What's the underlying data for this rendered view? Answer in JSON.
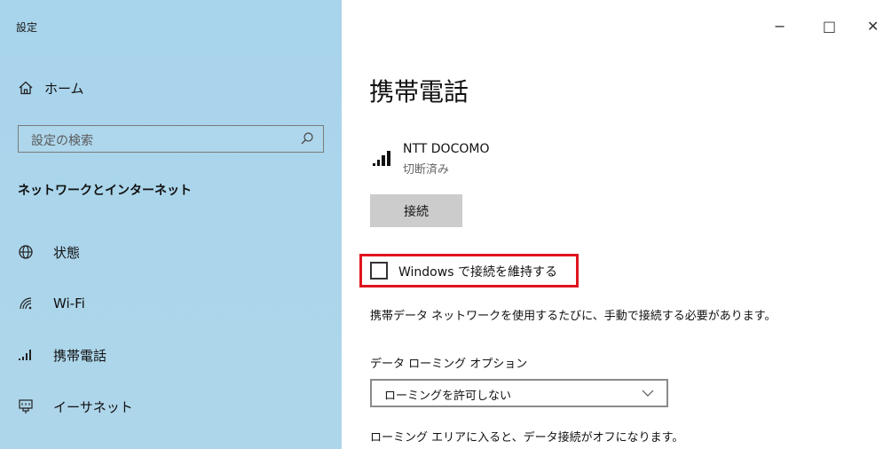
{
  "window": {
    "title": "設定",
    "minimize": "−",
    "maximize": "□",
    "close": "✕"
  },
  "sidebar": {
    "home_label": "ホーム",
    "search_placeholder": "設定の検索",
    "section_title": "ネットワークとインターネット",
    "items": [
      {
        "label": "状態",
        "icon": "globe-icon"
      },
      {
        "label": "Wi-Fi",
        "icon": "wifi-icon"
      },
      {
        "label": "携帯電話",
        "icon": "cellular-signal-icon"
      },
      {
        "label": "イーサネット",
        "icon": "ethernet-icon"
      }
    ]
  },
  "main": {
    "page_title": "携帯電話",
    "network_name": "NTT DOCOMO",
    "network_status": "切断済み",
    "connect_button": "接続",
    "keep_connected_label": "Windows で接続を維持する",
    "keep_connected_checked": false,
    "description": "携帯データ ネットワークを使用するたびに、手動で接続する必要があります。",
    "roaming_title": "データ ローミング オプション",
    "roaming_selected": "ローミングを許可しない",
    "roaming_description": "ローミング エリアに入ると、データ接続がオフになります。"
  },
  "colors": {
    "sidebar_bg": "#a9d3ea",
    "highlight_border": "#e0141e",
    "button_bg": "#cccccc"
  }
}
